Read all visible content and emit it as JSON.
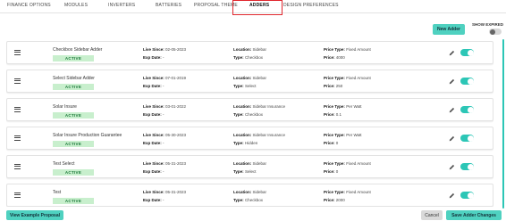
{
  "tabs": [
    {
      "label": "FINANCE OPTIONS",
      "active": false
    },
    {
      "label": "MODULES",
      "active": false
    },
    {
      "label": "INVERTERS",
      "active": false
    },
    {
      "label": "BATTERIES",
      "active": false
    },
    {
      "label": "PROPOSAL THEME",
      "active": false
    },
    {
      "label": "ADDERS",
      "active": true
    },
    {
      "label": "DESIGN PREFERENCES",
      "active": false
    }
  ],
  "controls": {
    "new_adder_label": "New Adder",
    "show_expired_label": "SHOW EXPIRED",
    "show_expired_on": false
  },
  "field_labels": {
    "live_since": "Live Since:",
    "exp_date": "Exp Date:",
    "location": "Location:",
    "type": "Type:",
    "price_type": "Price Type:",
    "price": "Price:"
  },
  "adders": [
    {
      "name": "Checkbox Sidebar Adder",
      "status": "ACTIVE",
      "live_since": "02-05-2023",
      "exp_date": "-",
      "location": "Sidebar",
      "type": "Checkbox",
      "price_type": "Fixed Amount",
      "price": "4000",
      "enabled": true
    },
    {
      "name": "Select Sidebar Adder",
      "status": "ACTIVE",
      "live_since": "07-01-2019",
      "exp_date": "-",
      "location": "Sidebar",
      "type": "Select",
      "price_type": "Fixed Amount",
      "price": "250",
      "enabled": true
    },
    {
      "name": "Solar Insure",
      "status": "ACTIVE",
      "live_since": "03-01-2022",
      "exp_date": "-",
      "location": "Sidebar Insurance",
      "type": "Checkbox",
      "price_type": "Per Watt",
      "price": "0.1",
      "enabled": true
    },
    {
      "name": "Solar Insure Production Guarantee",
      "status": "ACTIVE",
      "live_since": "05-30-2023",
      "exp_date": "-",
      "location": "Sidebar Insurance",
      "type": "Hidden",
      "price_type": "Per Watt",
      "price": "0",
      "enabled": true
    },
    {
      "name": "Test Select",
      "status": "ACTIVE",
      "live_since": "05-31-2023",
      "exp_date": "-",
      "location": "Sidebar",
      "type": "Select",
      "price_type": "Fixed Amount",
      "price": "0",
      "enabled": true
    },
    {
      "name": "Test",
      "status": "ACTIVE",
      "live_since": "05-31-2023",
      "exp_date": "-",
      "location": "Sidebar",
      "type": "Checkbox",
      "price_type": "Fixed Amount",
      "price": "2000",
      "enabled": true
    }
  ],
  "footer": {
    "example_label": "View Example Proposal",
    "cancel_label": "Cancel",
    "save_label": "Save Adder Changes"
  },
  "colors": {
    "accent": "#4fd1c0",
    "toggle_on": "#2cc6b6",
    "badge_bg": "#c8efcd",
    "badge_text": "#1d7a3a",
    "highlight": "#e0262d"
  }
}
